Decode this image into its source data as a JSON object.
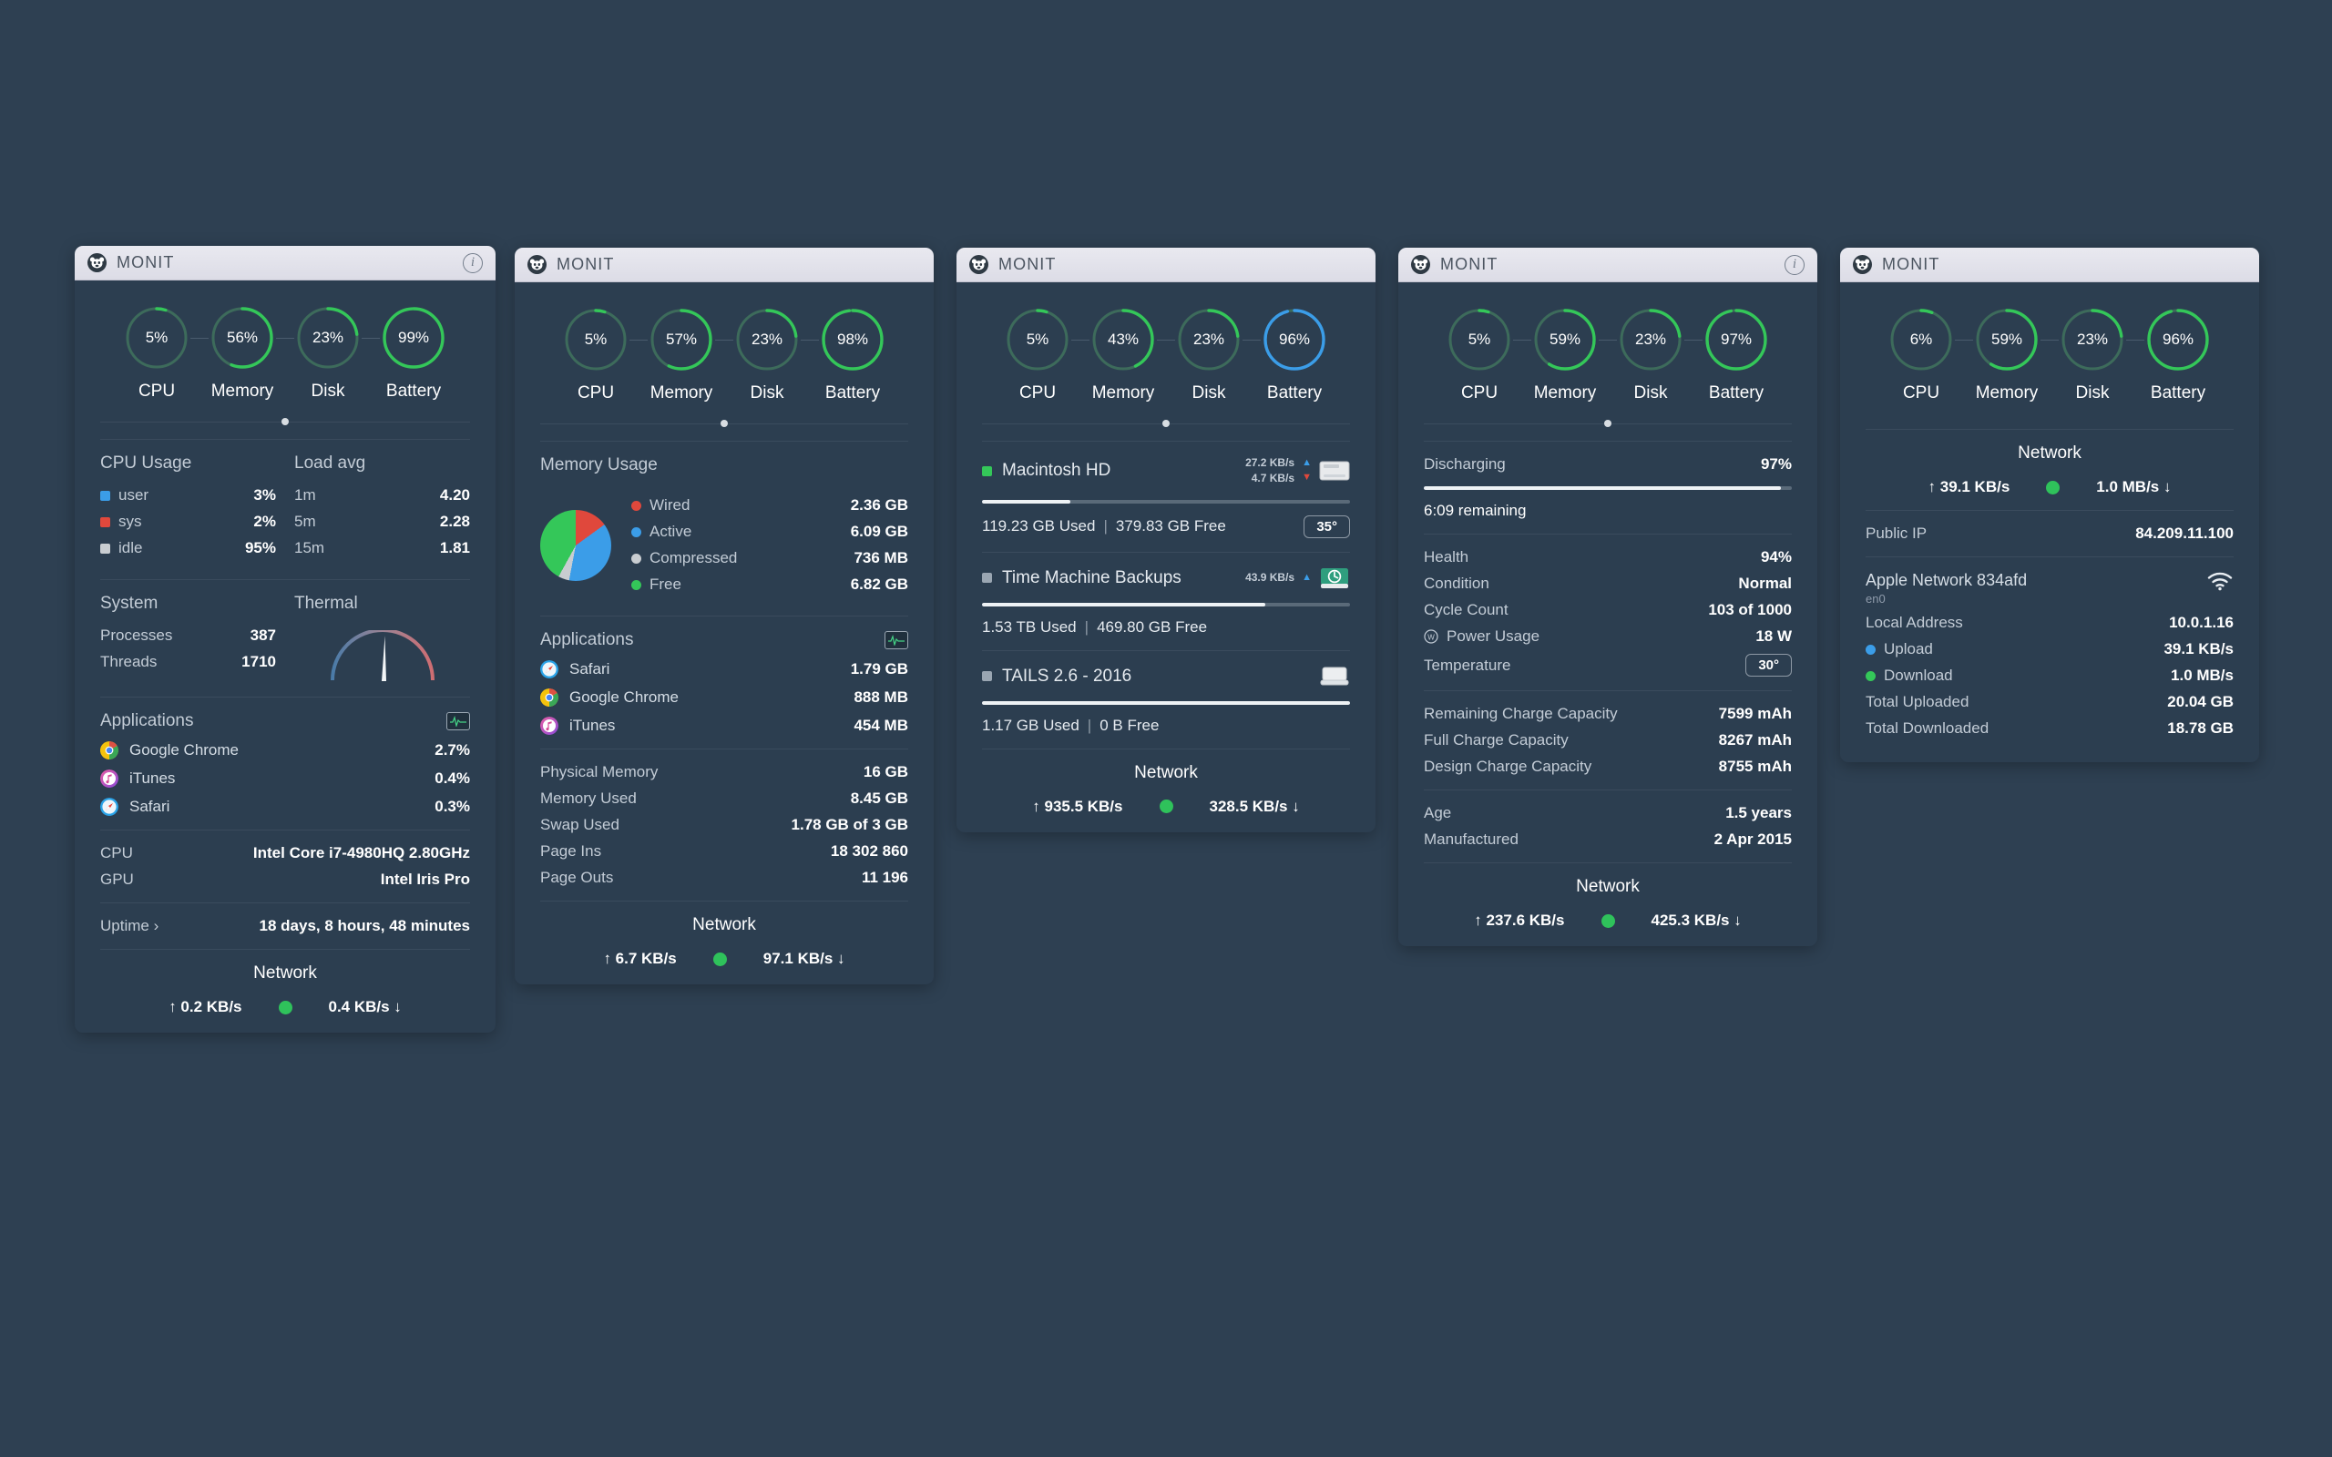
{
  "window": {
    "title": "MONIT",
    "logo_icon": "monit-logo-icon",
    "info_icon": "info-icon"
  },
  "labels": {
    "cpu": "CPU",
    "memory": "Memory",
    "disk": "Disk",
    "battery": "Battery",
    "network": "Network",
    "applications": "Applications"
  },
  "colors": {
    "background": "#2e4052",
    "panel": "#2c3e50",
    "green": "#34c759",
    "blue": "#3b9de8",
    "red": "#e0483c",
    "grey": "#c9cdd1",
    "track": "#3a5a50"
  },
  "panels": [
    {
      "id": "cpu-panel",
      "gauges": [
        {
          "label": "CPU",
          "value": "5%",
          "pct": 5,
          "color": "#34c759"
        },
        {
          "label": "Memory",
          "value": "56%",
          "pct": 56,
          "color": "#34c759"
        },
        {
          "label": "Disk",
          "value": "23%",
          "pct": 23,
          "color": "#34c759"
        },
        {
          "label": "Battery",
          "value": "99%",
          "pct": 99,
          "color": "#34c759"
        }
      ],
      "cpu_usage": {
        "title": "CPU Usage",
        "rows": [
          {
            "label": "user",
            "value": "3%",
            "color": "#3b9de8"
          },
          {
            "label": "sys",
            "value": "2%",
            "color": "#e0483c"
          },
          {
            "label": "idle",
            "value": "95%",
            "color": "#c9cdd1"
          }
        ]
      },
      "load_avg": {
        "title": "Load avg",
        "rows": [
          {
            "label": "1m",
            "value": "4.20"
          },
          {
            "label": "5m",
            "value": "2.28"
          },
          {
            "label": "15m",
            "value": "1.81"
          }
        ]
      },
      "system": {
        "title": "System",
        "rows": [
          {
            "label": "Processes",
            "value": "387"
          },
          {
            "label": "Threads",
            "value": "1710"
          }
        ]
      },
      "thermal": {
        "title": "Thermal",
        "icon": "thermal-gauge-icon"
      },
      "applications": {
        "title": "Applications",
        "action_icon": "activity-monitor-icon",
        "rows": [
          {
            "name": "Google Chrome",
            "value": "2.7%",
            "icon": "chrome-icon"
          },
          {
            "name": "iTunes",
            "value": "0.4%",
            "icon": "itunes-icon"
          },
          {
            "name": "Safari",
            "value": "0.3%",
            "icon": "safari-icon"
          }
        ]
      },
      "hardware": [
        {
          "label": "CPU",
          "value": "Intel Core i7-4980HQ 2.80GHz"
        },
        {
          "label": "GPU",
          "value": "Intel Iris Pro"
        }
      ],
      "uptime": {
        "label": "Uptime ›",
        "value": "18 days, 8 hours, 48 minutes"
      },
      "network": {
        "title": "Network",
        "up": "↑ 0.2 KB/s",
        "down": "0.4 KB/s ↓",
        "status_color": "#2fc25b"
      }
    },
    {
      "id": "memory-panel",
      "gauges": [
        {
          "label": "CPU",
          "value": "5%",
          "pct": 5,
          "color": "#34c759"
        },
        {
          "label": "Memory",
          "value": "57%",
          "pct": 57,
          "color": "#34c759"
        },
        {
          "label": "Disk",
          "value": "23%",
          "pct": 23,
          "color": "#34c759"
        },
        {
          "label": "Battery",
          "value": "98%",
          "pct": 98,
          "color": "#34c759"
        }
      ],
      "memory_usage": {
        "title": "Memory Usage",
        "rows": [
          {
            "label": "Wired",
            "value": "2.36 GB",
            "color": "#e0483c",
            "share": 15
          },
          {
            "label": "Active",
            "value": "6.09 GB",
            "color": "#3b9de8",
            "share": 38
          },
          {
            "label": "Compressed",
            "value": "736 MB",
            "color": "#c9cdd1",
            "share": 5
          },
          {
            "label": "Free",
            "value": "6.82 GB",
            "color": "#34c759",
            "share": 42
          }
        ]
      },
      "applications": {
        "title": "Applications",
        "action_icon": "activity-monitor-icon",
        "rows": [
          {
            "name": "Safari",
            "value": "1.79 GB",
            "icon": "safari-icon"
          },
          {
            "name": "Google Chrome",
            "value": "888 MB",
            "icon": "chrome-icon"
          },
          {
            "name": "iTunes",
            "value": "454 MB",
            "icon": "itunes-icon"
          }
        ]
      },
      "stats": [
        {
          "label": "Physical Memory",
          "value": "16 GB"
        },
        {
          "label": "Memory Used",
          "value": "8.45 GB"
        },
        {
          "label": "Swap Used",
          "value": "1.78 GB of 3 GB"
        },
        {
          "label": "Page Ins",
          "value": "18 302 860"
        },
        {
          "label": "Page Outs",
          "value": "11 196"
        }
      ],
      "network": {
        "title": "Network",
        "up": "↑ 6.7 KB/s",
        "down": "97.1 KB/s ↓",
        "status_color": "#2fc25b"
      }
    },
    {
      "id": "disk-panel",
      "gauges": [
        {
          "label": "CPU",
          "value": "5%",
          "pct": 5,
          "color": "#34c759"
        },
        {
          "label": "Memory",
          "value": "43%",
          "pct": 43,
          "color": "#34c759"
        },
        {
          "label": "Disk",
          "value": "23%",
          "pct": 23,
          "color": "#34c759"
        },
        {
          "label": "Battery",
          "value": "96%",
          "pct": 96,
          "color": "#3b9de8"
        }
      ],
      "volumes": [
        {
          "name": "Macintosh HD",
          "swatch": "#34c759",
          "read_rate": "27.2 KB/s",
          "write_rate": "4.7 KB/s",
          "used_pct": 24,
          "used": "119.23 GB Used",
          "free": "379.83 GB Free",
          "temp": "35°",
          "icon": "internal-drive-icon"
        },
        {
          "name": "Time Machine Backups",
          "swatch": "#9aa6b2",
          "read_rate": "43.9 KB/s",
          "write_rate": "",
          "used_pct": 77,
          "used": "1.53 TB Used",
          "free": "469.80 GB Free",
          "temp": "",
          "icon": "time-machine-drive-icon"
        },
        {
          "name": "TAILS 2.6 - 2016",
          "swatch": "#9aa6b2",
          "read_rate": "",
          "write_rate": "",
          "used_pct": 100,
          "used": "1.17 GB Used",
          "free": "0 B Free",
          "temp": "",
          "icon": "external-drive-icon"
        }
      ],
      "network": {
        "title": "Network",
        "up": "↑ 935.5 KB/s",
        "down": "328.5 KB/s ↓",
        "status_color": "#2fc25b"
      }
    },
    {
      "id": "battery-panel",
      "gauges": [
        {
          "label": "CPU",
          "value": "5%",
          "pct": 5,
          "color": "#34c759"
        },
        {
          "label": "Memory",
          "value": "59%",
          "pct": 59,
          "color": "#34c759"
        },
        {
          "label": "Disk",
          "value": "23%",
          "pct": 23,
          "color": "#34c759"
        },
        {
          "label": "Battery",
          "value": "97%",
          "pct": 97,
          "color": "#34c759"
        }
      ],
      "charge": {
        "state": "Discharging",
        "percent": "97%",
        "pct": 97,
        "remaining": "6:09  remaining"
      },
      "details": [
        {
          "label": "Health",
          "value": "94%",
          "accent": true
        },
        {
          "label": "Condition",
          "value": "Normal"
        },
        {
          "label": "Cycle Count",
          "value": "103 of 1000"
        },
        {
          "label": "Power Usage",
          "value": "18 W",
          "icon": "watt-icon"
        },
        {
          "label": "Temperature",
          "value": "30°",
          "pill": true
        }
      ],
      "capacity": [
        {
          "label": "Remaining Charge Capacity",
          "value": "7599 mAh"
        },
        {
          "label": "Full Charge Capacity",
          "value": "8267 mAh"
        },
        {
          "label": "Design Charge Capacity",
          "value": "8755 mAh"
        }
      ],
      "age": [
        {
          "label": "Age",
          "value": "1.5 years"
        },
        {
          "label": "Manufactured",
          "value": "2 Apr 2015"
        }
      ],
      "network": {
        "title": "Network",
        "up": "↑ 237.6 KB/s",
        "down": "425.3 KB/s ↓",
        "status_color": "#2fc25b"
      }
    },
    {
      "id": "network-panel",
      "gauges": [
        {
          "label": "CPU",
          "value": "6%",
          "pct": 6,
          "color": "#34c759"
        },
        {
          "label": "Memory",
          "value": "59%",
          "pct": 59,
          "color": "#34c759"
        },
        {
          "label": "Disk",
          "value": "23%",
          "pct": 23,
          "color": "#34c759"
        },
        {
          "label": "Battery",
          "value": "96%",
          "pct": 96,
          "color": "#34c759"
        }
      ],
      "network": {
        "title": "Network",
        "up": "↑ 39.1 KB/s",
        "down": "1.0 MB/s ↓",
        "status_color": "#2fc25b"
      },
      "public_ip": {
        "label": "Public IP",
        "value": "84.209.11.100"
      },
      "interface": {
        "name": "Apple Network 834afd",
        "device": "en0",
        "icon": "wifi-icon"
      },
      "interface_rows": [
        {
          "label": "Local Address",
          "value": "10.0.1.16"
        },
        {
          "label": "Upload",
          "value": "39.1 KB/s",
          "color": "#3b9de8"
        },
        {
          "label": "Download",
          "value": "1.0 MB/s",
          "color": "#34c759"
        },
        {
          "label": "Total Uploaded",
          "value": "20.04 GB"
        },
        {
          "label": "Total Downloaded",
          "value": "18.78 GB"
        }
      ]
    }
  ]
}
